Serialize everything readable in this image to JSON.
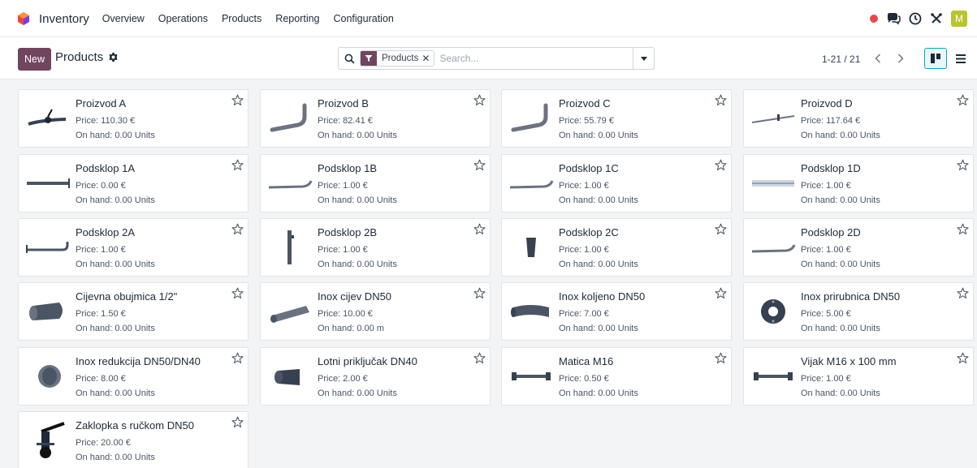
{
  "navbar": {
    "app_name": "Inventory",
    "menu": [
      "Overview",
      "Operations",
      "Products",
      "Reporting",
      "Configuration"
    ],
    "user_initial": "M",
    "icons": [
      "status-dot-icon",
      "chat-icon",
      "clock-icon",
      "tools-icon"
    ]
  },
  "controlbar": {
    "new_label": "New",
    "title": "Products",
    "search": {
      "facet_label": "Products",
      "facet_remove": "✕",
      "placeholder": "Search..."
    },
    "pager": "1-21 / 21"
  },
  "colors": {
    "brand": "#71455f",
    "accent": "#0ea5b4",
    "status_dot": "#e5484d",
    "avatar": "#b8c430"
  },
  "products": [
    {
      "name": "Proizvod A",
      "price": "Price: 110.30 €",
      "on_hand": "On hand: 0.00 Units",
      "thumb": "valve-pipe"
    },
    {
      "name": "Proizvod B",
      "price": "Price: 82.41 €",
      "on_hand": "On hand: 0.00 Units",
      "thumb": "bent-pipe"
    },
    {
      "name": "Proizvod C",
      "price": "Price: 55.79 €",
      "on_hand": "On hand: 0.00 Units",
      "thumb": "bent-pipe"
    },
    {
      "name": "Proizvod D",
      "price": "Price: 117.64 €",
      "on_hand": "On hand: 0.00 Units",
      "thumb": "flange-pipe"
    },
    {
      "name": "Podsklop 1A",
      "price": "Price: 0.00 €",
      "on_hand": "On hand: 0.00 Units",
      "thumb": "straight-pipe"
    },
    {
      "name": "Podsklop 1B",
      "price": "Price: 1.00 €",
      "on_hand": "On hand: 0.00 Units",
      "thumb": "curved-pipe"
    },
    {
      "name": "Podsklop 1C",
      "price": "Price: 1.00 €",
      "on_hand": "On hand: 0.00 Units",
      "thumb": "curved-pipe"
    },
    {
      "name": "Podsklop 1D",
      "price": "Price: 1.00 €",
      "on_hand": "On hand: 0.00 Units",
      "thumb": "long-pipe"
    },
    {
      "name": "Podsklop 2A",
      "price": "Price: 1.00 €",
      "on_hand": "On hand: 0.00 Units",
      "thumb": "elbow-pipe"
    },
    {
      "name": "Podsklop 2B",
      "price": "Price: 1.00 €",
      "on_hand": "On hand: 0.00 Units",
      "thumb": "vertical-pipe"
    },
    {
      "name": "Podsklop 2C",
      "price": "Price: 1.00 €",
      "on_hand": "On hand: 0.00 Units",
      "thumb": "short-tube"
    },
    {
      "name": "Podsklop 2D",
      "price": "Price: 1.00 €",
      "on_hand": "On hand: 0.00 Units",
      "thumb": "curved-pipe"
    },
    {
      "name": "Cijevna obujmica 1/2\"",
      "price": "Price: 1.50 €",
      "on_hand": "On hand: 0.00 Units",
      "thumb": "cylinder"
    },
    {
      "name": "Inox cijev DN50",
      "price": "Price: 10.00 €",
      "on_hand": "On hand: 0.00 m",
      "thumb": "tube"
    },
    {
      "name": "Inox koljeno DN50",
      "price": "Price: 7.00 €",
      "on_hand": "On hand: 0.00 Units",
      "thumb": "elbow"
    },
    {
      "name": "Inox prirubnica DN50",
      "price": "Price: 5.00 €",
      "on_hand": "On hand: 0.00 Units",
      "thumb": "flange"
    },
    {
      "name": "Inox redukcija DN50/DN40",
      "price": "Price: 8.00 €",
      "on_hand": "On hand: 0.00 Units",
      "thumb": "reducer"
    },
    {
      "name": "Lotni priključak DN40",
      "price": "Price: 2.00 €",
      "on_hand": "On hand: 0.00 Units",
      "thumb": "ferrule"
    },
    {
      "name": "Matica M16",
      "price": "Price: 0.50 €",
      "on_hand": "On hand: 0.00 Units",
      "thumb": "bolt"
    },
    {
      "name": "Vijak M16 x 100 mm",
      "price": "Price: 1.00 €",
      "on_hand": "On hand: 0.00 Units",
      "thumb": "bolt"
    },
    {
      "name": "Zaklopka s ručkom DN50",
      "price": "Price: 20.00 €",
      "on_hand": "On hand: 0.00 Units",
      "thumb": "butterfly-valve"
    }
  ]
}
